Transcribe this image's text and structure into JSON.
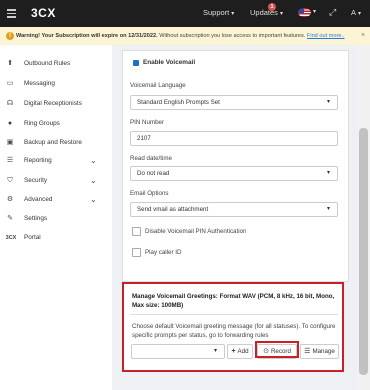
{
  "topbar": {
    "brand_logo": "3CX",
    "support_label": "Support",
    "updates_label": "Updates",
    "updates_badge": "1",
    "user_label": "A"
  },
  "banner": {
    "strong": "Warning! Your Subscription will expire on 12/31/2022.",
    "text": "Without subscription you lose access to important features.",
    "link": "Find out more.."
  },
  "sidebar": {
    "items": [
      {
        "label": "Outbound Rules",
        "icon": "arrow-up-icon",
        "has_chevron": false
      },
      {
        "label": "Messaging",
        "icon": "chat-icon",
        "has_chevron": false
      },
      {
        "label": "Digital Receptionists",
        "icon": "headset-icon",
        "has_chevron": false
      },
      {
        "label": "Ring Groups",
        "icon": "users-icon",
        "has_chevron": false
      },
      {
        "label": "Backup and Restore",
        "icon": "backup-icon",
        "has_chevron": false
      },
      {
        "label": "Reporting",
        "icon": "list-icon",
        "has_chevron": true
      },
      {
        "label": "Security",
        "icon": "shield-icon",
        "has_chevron": true
      },
      {
        "label": "Advanced",
        "icon": "gear-icon",
        "has_chevron": true
      },
      {
        "label": "Settings",
        "icon": "wrench-icon",
        "has_chevron": false
      },
      {
        "label": "Portal",
        "icon": "3cx-icon",
        "has_chevron": false
      }
    ]
  },
  "form": {
    "enable_voicemail_label": "Enable Voicemail",
    "language_label": "Voicemail Language",
    "language_value": "Standard English Prompts Set",
    "pin_label": "PIN Number",
    "pin_value": "2107",
    "readdate_label": "Read date/time",
    "readdate_value": "Do not read",
    "email_label": "Email Options",
    "email_value": "Send vmail as attachment",
    "disable_pin_label": "Disable Voicemail PIN Authentication",
    "play_callerid_label": "Play caller ID"
  },
  "greetings": {
    "title": "Manage Voicemail Greetings: Format WAV (PCM, 8 kHz, 16 bit, Mono, Max size: 100MB)",
    "description": "Choose default Voicemail greeting message (for all statuses). To configure specific prompts per status, go to forwarding rules",
    "add_label": "Add",
    "record_label": "Record",
    "manage_label": "Manage"
  },
  "colors": {
    "topbar": "#1e1e1e",
    "accent_blue": "#1e70c9",
    "highlight_red": "#c8202a",
    "warning_bg": "#fbf5d6"
  }
}
